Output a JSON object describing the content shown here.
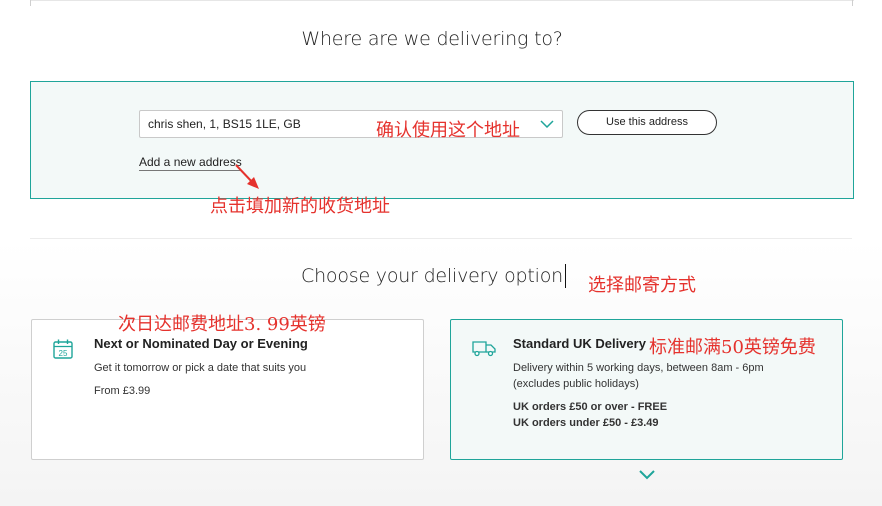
{
  "address_section": {
    "title": "Where are we delivering to?",
    "selected_address": "chris shen, 1, BS15 1LE, GB",
    "use_button": "Use this address",
    "add_link": "Add a new address"
  },
  "delivery_section": {
    "title": "Choose your delivery option",
    "options": [
      {
        "title": "Next or Nominated Day or Evening",
        "icon": "calendar-icon",
        "calendar_day": "25",
        "description": "Get it tomorrow or pick a date that suits you",
        "price": "From £3.99",
        "selected": false
      },
      {
        "title": "Standard UK Delivery",
        "icon": "truck-icon",
        "description_line1": "Delivery within 5 working days, between 8am - 6pm",
        "description_line2": "(excludes public holidays)",
        "pricing_line1": "UK orders £50 or over - FREE",
        "pricing_line2": "UK orders under £50 - £3.49",
        "selected": true
      }
    ]
  },
  "annotations": {
    "confirm_address": "确认使用这个地址",
    "add_new_address": "点击填加新的收货地址",
    "choose_method": "选择邮寄方式",
    "next_day_price": "次日达邮费地址3. 99英镑",
    "standard_free": "标准邮满50英镑免费"
  },
  "colors": {
    "accent": "#1fa59a",
    "panel_bg": "#f3f9f8",
    "annotation": "#e5322d"
  }
}
